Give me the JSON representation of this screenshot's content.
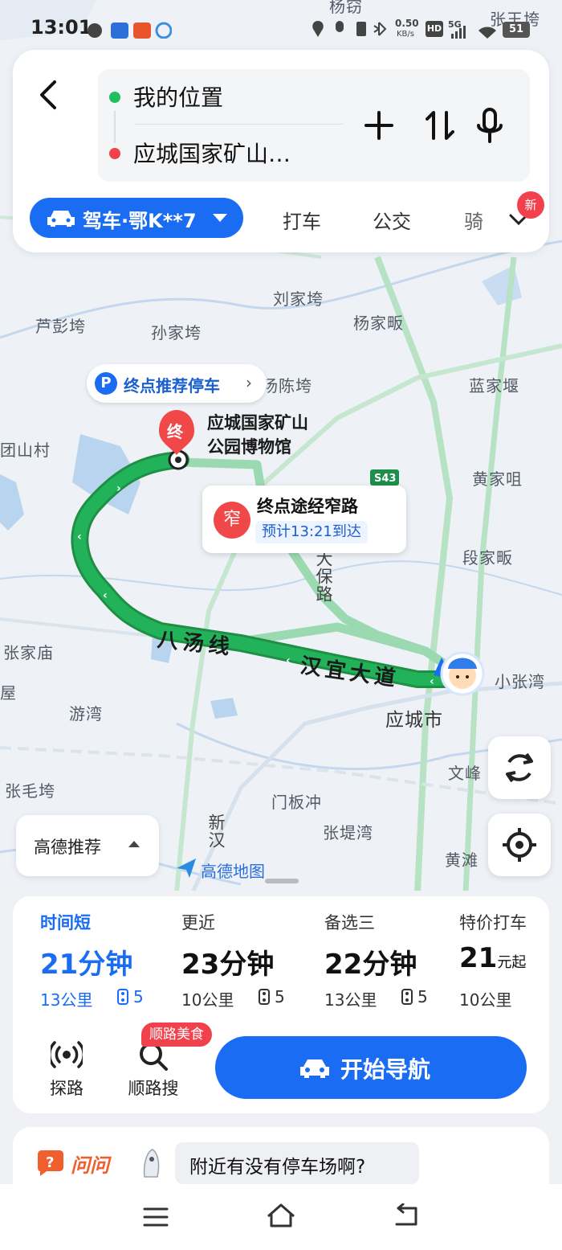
{
  "status_bar": {
    "time": "13:01",
    "net_speed_value": "0.50",
    "net_speed_unit": "KB/s",
    "hd_label": "HD",
    "signal_label": "5G",
    "battery": "51"
  },
  "route_card": {
    "origin": "我的位置",
    "destination": "应城国家矿山…",
    "add_stop_icon": "plus-icon",
    "swap_icon": "swap-icon",
    "voice_icon": "mic-icon"
  },
  "modes": {
    "drive": "驾车·鄂K**7",
    "taxi": "打车",
    "transit": "公交",
    "ride": "骑",
    "new_badge": "新"
  },
  "map": {
    "parking_tip": "终点推荐停车",
    "parking_icon_label": "P",
    "dest_marker": "终",
    "dest_name_line1": "应城国家矿山",
    "dest_name_line2": "公园博物馆",
    "highway_tag": "S43",
    "narrow_icon": "窄",
    "narrow_title": "终点途经窄路",
    "narrow_eta": "预计13:21到达",
    "road_labels": [
      "八汤线",
      "汉宜大道",
      "大保路",
      "新汉"
    ],
    "places": [
      "杨窃",
      "张王垮",
      "刘家垮",
      "芦彭垮",
      "孙家垮",
      "杨家畈",
      "汤陈垮",
      "蓝家堰",
      "团山村",
      "黄家咀",
      "段家畈",
      "张家庙",
      "小张湾",
      "游湾",
      "应城市",
      "文峰",
      "张毛垮",
      "门板冲",
      "张堤湾",
      "黄滩",
      "屋"
    ],
    "map_pref": "高德推荐",
    "brand": "高德地图"
  },
  "routes": [
    {
      "tag": "时间短",
      "duration": "21分钟",
      "distance": "13公里",
      "lights": "5"
    },
    {
      "tag": "更近",
      "duration": "23分钟",
      "distance": "10公里",
      "lights": "5"
    },
    {
      "tag": "备选三",
      "duration": "22分钟",
      "distance": "13公里",
      "lights": "5"
    },
    {
      "tag": "特价打车",
      "duration_value": "21",
      "duration_unit": "元起",
      "distance": "10公里"
    }
  ],
  "tools": {
    "explore": "探路",
    "search_along": "顺路搜",
    "food_badge": "顺路美食",
    "start_nav": "开始导航"
  },
  "ask": {
    "brand": "问问",
    "question": "附近有没有停车场啊?"
  },
  "colors": {
    "accent": "#1a6df2",
    "route_green": "#1fae57",
    "alert_red": "#f04848"
  }
}
